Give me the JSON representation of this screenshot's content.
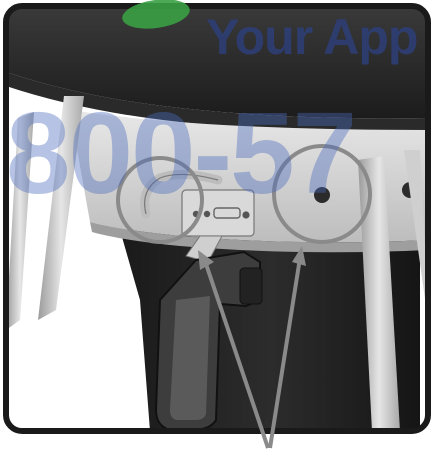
{
  "watermark": {
    "brand_text": "Your App",
    "phone_text": "800-57",
    "brand_color": "#2d3f78",
    "phone_color": "#4a6bbd",
    "leaf_color": "#3aa043"
  },
  "illustration": {
    "subject": "grill-lid-hinge-detail",
    "callout_count": 2,
    "callout_color": "#8a8a8a",
    "frame_color": "#1a1a1a"
  }
}
